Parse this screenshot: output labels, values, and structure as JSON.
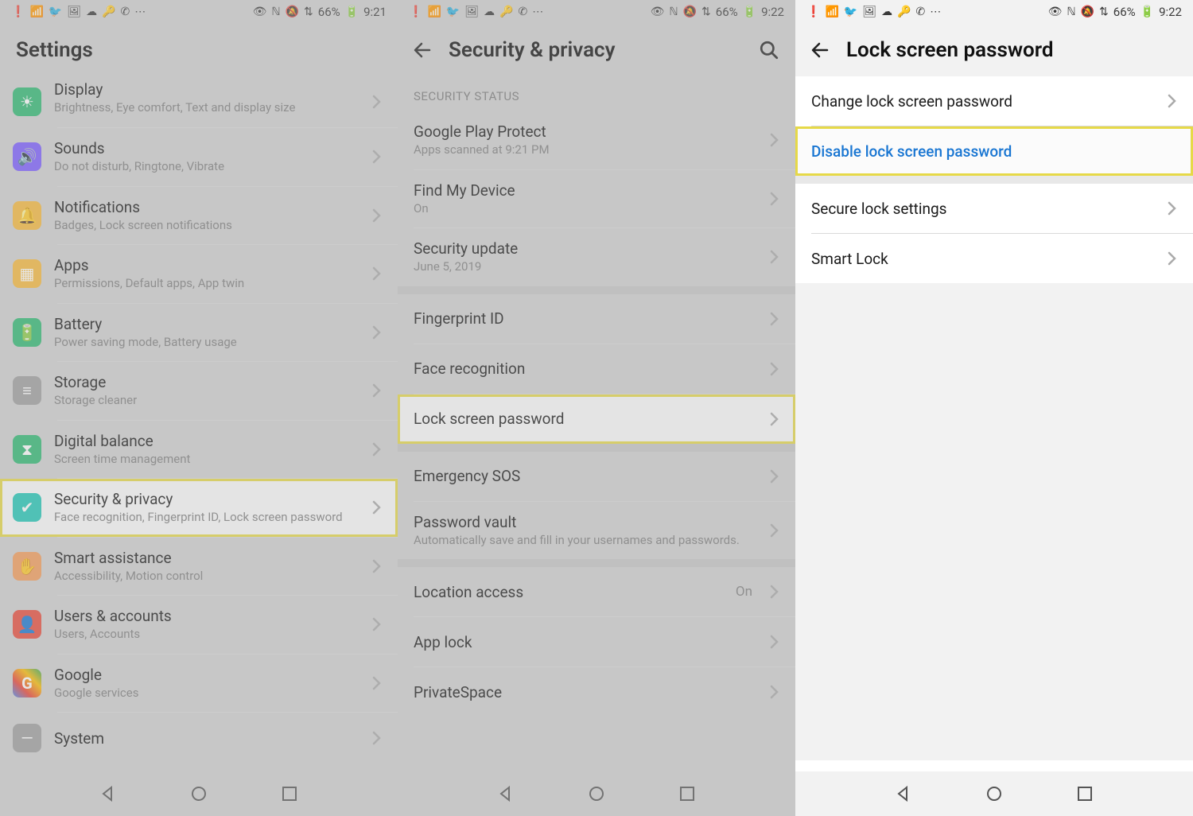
{
  "status": {
    "left_icons": [
      "!",
      "wifi",
      "twitter",
      "photo",
      "cloud",
      "key",
      "whatsapp",
      "…"
    ],
    "right_icons": [
      "eye",
      "nfc",
      "mute",
      "data"
    ],
    "battery_pct": "66%",
    "time1": "9:21",
    "time2": "9:22"
  },
  "screen1": {
    "title": "Settings",
    "items": [
      {
        "icon": "display",
        "color": "#2eb872",
        "label": "Display",
        "sub": "Brightness, Eye comfort, Text and display size",
        "cut": true
      },
      {
        "icon": "sound",
        "color": "#7b5cff",
        "label": "Sounds",
        "sub": "Do not disturb, Ringtone, Vibrate"
      },
      {
        "icon": "bell",
        "color": "#f6b93b",
        "label": "Notifications",
        "sub": "Badges, Lock screen notifications"
      },
      {
        "icon": "apps",
        "color": "#f6b93b",
        "label": "Apps",
        "sub": "Permissions, Default apps, App twin"
      },
      {
        "icon": "battery",
        "color": "#2eb872",
        "label": "Battery",
        "sub": "Power saving mode, Battery usage"
      },
      {
        "icon": "storage",
        "color": "#9e9e9e",
        "label": "Storage",
        "sub": "Storage cleaner"
      },
      {
        "icon": "hourglass",
        "color": "#2eb872",
        "label": "Digital balance",
        "sub": "Screen time management"
      },
      {
        "icon": "shield",
        "color": "#21c7b7",
        "label": "Security & privacy",
        "sub": "Face recognition, Fingerprint ID, Lock screen password",
        "highlight": true
      },
      {
        "icon": "hand",
        "color": "#f39c5a",
        "label": "Smart assistance",
        "sub": "Accessibility, Motion control"
      },
      {
        "icon": "user",
        "color": "#e74c3c",
        "label": "Users & accounts",
        "sub": "Users, Accounts"
      },
      {
        "icon": "google",
        "color": "#ffffff",
        "label": "Google",
        "sub": "Google services"
      },
      {
        "icon": "system",
        "color": "#9e9e9e",
        "label": "System",
        "sub": ""
      }
    ]
  },
  "screen2": {
    "title": "Security & privacy",
    "section_header": "SECURITY STATUS",
    "groups": [
      [
        {
          "label": "Google Play Protect",
          "sub": "Apps scanned at 9:21 PM"
        },
        {
          "label": "Find My Device",
          "sub": "On"
        },
        {
          "label": "Security update",
          "sub": "June 5, 2019"
        }
      ],
      [
        {
          "label": "Fingerprint ID"
        },
        {
          "label": "Face recognition"
        },
        {
          "label": "Lock screen password",
          "highlight": true
        }
      ],
      [
        {
          "label": "Emergency SOS"
        },
        {
          "label": "Password vault",
          "sub": "Automatically save and fill in your usernames and passwords."
        }
      ],
      [
        {
          "label": "Location access",
          "trailing": "On"
        },
        {
          "label": "App lock"
        },
        {
          "label": "PrivateSpace"
        }
      ]
    ]
  },
  "screen3": {
    "title": "Lock screen password",
    "groups": [
      [
        {
          "label": "Change lock screen password"
        },
        {
          "label": "Disable lock screen password",
          "link": true,
          "highlight": true
        }
      ],
      [
        {
          "label": "Secure lock settings"
        },
        {
          "label": "Smart Lock"
        }
      ]
    ]
  }
}
